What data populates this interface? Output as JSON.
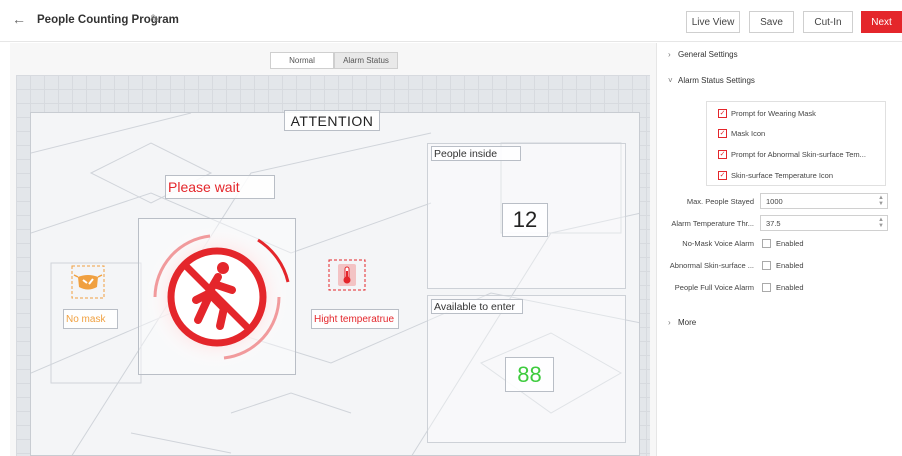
{
  "header": {
    "back_icon": "arrow-left-icon",
    "title": "People Counting Program",
    "edit_icon": "pencil-icon",
    "buttons": {
      "live_view": "Live View",
      "save": "Save",
      "cut_in": "Cut-In",
      "next": "Next"
    }
  },
  "mode_tabs": [
    {
      "label": "Normal",
      "active": false
    },
    {
      "label": "Alarm Status",
      "active": true
    }
  ],
  "canvas": {
    "attention": "ATTENTION",
    "please_wait": "Please wait",
    "no_mask": "No mask",
    "high_temperature": "Hight temperatrue",
    "people_inside_label": "People inside",
    "people_inside_value": "12",
    "available_label": "Available to enter",
    "available_value": "88",
    "icons": {
      "no_mask": "no-mask-icon",
      "temperature": "thermometer-icon",
      "stop": "no-entry-person-icon"
    },
    "colors": {
      "alert_red": "#e4262b",
      "mask_orange": "#f0a040",
      "available_green": "#3ecb3e"
    }
  },
  "settings": {
    "general_settings": "General Settings",
    "alarm_status_settings": "Alarm Status Settings",
    "checkboxes": [
      {
        "label": "Prompt for Wearing Mask",
        "checked": true
      },
      {
        "label": "Mask Icon",
        "checked": true
      },
      {
        "label": "Prompt for Abnormal Skin-surface Tem...",
        "checked": true
      },
      {
        "label": "Skin-surface Temperature Icon",
        "checked": true
      }
    ],
    "max_people_label": "Max. People Stayed",
    "max_people_value": "1000",
    "alarm_temp_label": "Alarm Temperature Thr...",
    "alarm_temp_value": "37.5",
    "no_mask_voice_label": "No-Mask Voice Alarm",
    "abnormal_skin_label": "Abnormal Skin-surface ...",
    "people_full_voice_label": "People Full Voice Alarm",
    "enabled_label": "Enabled",
    "more": "More"
  }
}
